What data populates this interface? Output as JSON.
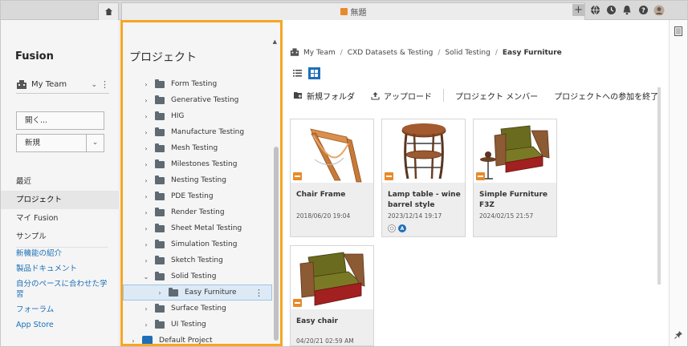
{
  "topbar": {
    "home_icon": "home-icon",
    "doc_tab_title": "無題",
    "close_glyph": "×",
    "plus_glyph": "+",
    "icons": [
      "globe-icon",
      "clock-icon",
      "bell-icon",
      "help-icon",
      "user-avatar-icon"
    ]
  },
  "leftnav": {
    "brand": "Fusion",
    "team": "My Team",
    "team_chevron": "⌄",
    "team_kebab": "⋮",
    "open_button": "開く...",
    "new_button": "新規",
    "new_arrow": "⌄",
    "items": [
      {
        "label": "最近",
        "active": false
      },
      {
        "label": "プロジェクト",
        "active": true
      },
      {
        "label": "マイ Fusion",
        "active": false
      },
      {
        "label": "サンプル",
        "active": false
      }
    ],
    "links": [
      "新機能の紹介",
      "製品ドキュメント",
      "自分のペースに合わせた学習",
      "フォーラム",
      "App Store"
    ]
  },
  "tree": {
    "title": "プロジェクト",
    "scroll_up": "▲",
    "row_kebab": "⋮",
    "items": [
      {
        "label": "Form Testing",
        "arrow": "›",
        "type": "folder",
        "indent": 1,
        "selected": false
      },
      {
        "label": "Generative Testing",
        "arrow": "›",
        "type": "folder",
        "indent": 1,
        "selected": false
      },
      {
        "label": "HIG",
        "arrow": "›",
        "type": "folder",
        "indent": 1,
        "selected": false
      },
      {
        "label": "Manufacture Testing",
        "arrow": "›",
        "type": "folder",
        "indent": 1,
        "selected": false
      },
      {
        "label": "Mesh Testing",
        "arrow": "›",
        "type": "folder",
        "indent": 1,
        "selected": false
      },
      {
        "label": "Milestones Testing",
        "arrow": "›",
        "type": "folder",
        "indent": 1,
        "selected": false
      },
      {
        "label": "Nesting Testing",
        "arrow": "›",
        "type": "folder",
        "indent": 1,
        "selected": false
      },
      {
        "label": "PDE Testing",
        "arrow": "›",
        "type": "folder",
        "indent": 1,
        "selected": false
      },
      {
        "label": "Render Testing",
        "arrow": "›",
        "type": "folder",
        "indent": 1,
        "selected": false
      },
      {
        "label": "Sheet Metal Testing",
        "arrow": "›",
        "type": "folder",
        "indent": 1,
        "selected": false
      },
      {
        "label": "Simulation Testing",
        "arrow": "›",
        "type": "folder",
        "indent": 1,
        "selected": false
      },
      {
        "label": "Sketch Testing",
        "arrow": "›",
        "type": "folder",
        "indent": 1,
        "selected": false
      },
      {
        "label": "Solid Testing",
        "arrow": "⌄",
        "type": "folder",
        "indent": 1,
        "selected": false
      },
      {
        "label": "Easy Furniture",
        "arrow": "›",
        "type": "folder",
        "indent": 2,
        "selected": true
      },
      {
        "label": "Surface Testing",
        "arrow": "›",
        "type": "folder",
        "indent": 1,
        "selected": false
      },
      {
        "label": "UI Testing",
        "arrow": "›",
        "type": "folder",
        "indent": 1,
        "selected": false
      },
      {
        "label": "Default Project",
        "arrow": "›",
        "type": "project",
        "indent": 0,
        "selected": false
      }
    ]
  },
  "main": {
    "breadcrumb": [
      "My Team",
      "CXD Datasets & Testing",
      "Solid Testing",
      "Easy Furniture"
    ],
    "breadcrumb_sep": "/",
    "toolbar": {
      "new_folder": "新規フォルダ",
      "upload": "アップロード",
      "project_members": "プロジェクト メンバー",
      "leave_project": "プロジェクトへの参加を終了"
    },
    "cards": [
      {
        "name": "Chair Frame",
        "date": "2018/06/20 19:04",
        "thumb": "chair-frame",
        "badges": []
      },
      {
        "name": "Lamp table - wine barrel style",
        "date": "2023/12/14 19:17",
        "thumb": "lamp-table",
        "badges": [
          "gray",
          "A"
        ]
      },
      {
        "name": "Simple Furniture F3Z",
        "date": "2024/02/15 21:57",
        "thumb": "simple-furniture",
        "badges": []
      },
      {
        "name": "Easy chair",
        "date": "04/20/21 02:59 AM",
        "thumb": "easy-chair",
        "badges": []
      }
    ]
  },
  "rightrail": {
    "icons": [
      "panel-icon",
      "pin-icon"
    ]
  },
  "colors": {
    "highlight_border": "#f5a623",
    "accent": "#1f6fb8",
    "file_badge": "#e88a2b"
  }
}
